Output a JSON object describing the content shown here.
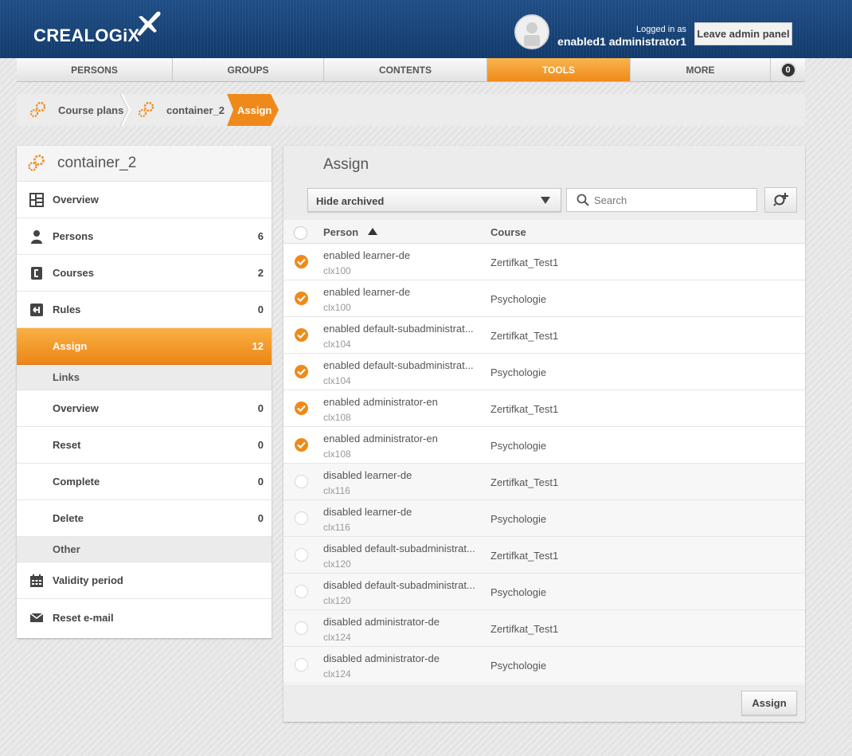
{
  "app": {
    "logo_text": "CREALOGiX"
  },
  "header": {
    "logged_in_label": "Logged in as",
    "user_name": "enabled1 administrator1",
    "leave_label": "Leave admin panel"
  },
  "nav": {
    "tabs": [
      {
        "label": "PERSONS",
        "active": false
      },
      {
        "label": "GROUPS",
        "active": false
      },
      {
        "label": "CONTENTS",
        "active": false
      },
      {
        "label": "TOOLS",
        "active": true
      },
      {
        "label": "MORE",
        "active": false
      }
    ],
    "badge": "0"
  },
  "breadcrumb": [
    "Course plans",
    "container_2",
    "Assign"
  ],
  "sidebar": {
    "title": "container_2",
    "items": [
      {
        "label": "Overview",
        "count": "",
        "icon": "overview-icon"
      },
      {
        "label": "Persons",
        "count": "6",
        "icon": "person-icon"
      },
      {
        "label": "Courses",
        "count": "2",
        "icon": "course-icon"
      },
      {
        "label": "Rules",
        "count": "0",
        "icon": "rules-icon"
      },
      {
        "label": "Assign",
        "count": "12",
        "icon": ""
      }
    ],
    "links_section": "Links",
    "links": [
      {
        "label": "Overview",
        "count": "0"
      },
      {
        "label": "Reset",
        "count": "0"
      },
      {
        "label": "Complete",
        "count": "0"
      },
      {
        "label": "Delete",
        "count": "0"
      }
    ],
    "other_section": "Other",
    "other": [
      {
        "label": "Validity period",
        "icon": "calendar-icon"
      },
      {
        "label": "Reset e-mail",
        "icon": "envelope-icon"
      }
    ]
  },
  "main": {
    "title": "Assign",
    "filter_value": "Hide archived",
    "search_placeholder": "Search",
    "columns": {
      "person": "Person",
      "course": "Course"
    },
    "rows": [
      {
        "name": "enabled learner-de",
        "login": "clx100",
        "course": "Zertifkat_Test1",
        "checked": true
      },
      {
        "name": "enabled learner-de",
        "login": "clx100",
        "course": "Psychologie",
        "checked": true
      },
      {
        "name": "enabled default-subadministrat...",
        "login": "clx104",
        "course": "Zertifkat_Test1",
        "checked": true
      },
      {
        "name": "enabled default-subadministrat...",
        "login": "clx104",
        "course": "Psychologie",
        "checked": true
      },
      {
        "name": "enabled administrator-en",
        "login": "clx108",
        "course": "Zertifkat_Test1",
        "checked": true
      },
      {
        "name": "enabled administrator-en",
        "login": "clx108",
        "course": "Psychologie",
        "checked": true
      },
      {
        "name": "disabled learner-de",
        "login": "clx116",
        "course": "Zertifkat_Test1",
        "checked": false
      },
      {
        "name": "disabled learner-de",
        "login": "clx116",
        "course": "Psychologie",
        "checked": false
      },
      {
        "name": "disabled default-subadministrat...",
        "login": "clx120",
        "course": "Zertifkat_Test1",
        "checked": false
      },
      {
        "name": "disabled default-subadministrat...",
        "login": "clx120",
        "course": "Psychologie",
        "checked": false
      },
      {
        "name": "disabled administrator-de",
        "login": "clx124",
        "course": "Zertifkat_Test1",
        "checked": false
      },
      {
        "name": "disabled administrator-de",
        "login": "clx124",
        "course": "Psychologie",
        "checked": false
      }
    ],
    "assign_label": "Assign"
  },
  "colors": {
    "accent": "#ef8a1a",
    "header": "#1a4478"
  }
}
